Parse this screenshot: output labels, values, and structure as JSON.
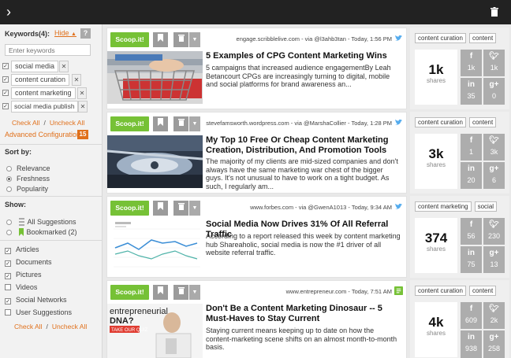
{
  "topbar": {
    "chevron_icon": "chevron-right-icon",
    "trash_icon": "trash-icon"
  },
  "sidebar": {
    "keywords_heading": "Keywords(4):",
    "hide_label": "Hide",
    "help_label": "?",
    "keyword_input_placeholder": "Enter keywords",
    "keywords": [
      {
        "label": "social media",
        "checked": true
      },
      {
        "label": "content curation",
        "checked": true
      },
      {
        "label": "content marketing",
        "checked": true
      },
      {
        "label": "social media publish",
        "checked": true
      }
    ],
    "check_all": "Check All",
    "uncheck_all": "Uncheck All",
    "advanced_configuration": "Advanced Configuration",
    "advanced_count": "15",
    "sort_heading": "Sort by:",
    "sort_options": [
      {
        "label": "Relevance",
        "selected": false
      },
      {
        "label": "Freshness",
        "selected": true
      },
      {
        "label": "Popularity",
        "selected": false
      }
    ],
    "show_heading": "Show:",
    "show_options": [
      {
        "label": "All Suggestions",
        "selected": false
      },
      {
        "label": "Bookmarked (2)",
        "selected": false
      }
    ],
    "types": [
      {
        "label": "Articles",
        "checked": true
      },
      {
        "label": "Documents",
        "checked": true
      },
      {
        "label": "Pictures",
        "checked": true
      },
      {
        "label": "Videos",
        "checked": false
      },
      {
        "label": "Social Networks",
        "checked": true
      },
      {
        "label": "User Suggestions",
        "checked": false
      }
    ],
    "check_all_2": "Check All",
    "uncheck_all_2": "Uncheck All"
  },
  "card_buttons": {
    "scoop": "Scoop.it!",
    "bookmark_icon": "bookmark-icon",
    "delete_icon": "trash-icon",
    "dropdown_icon": "caret-down-icon"
  },
  "cards": [
    {
      "meta": "engage.scribblelive.com - via @l3ahb3tan - Today, 1:56 PM",
      "source_icon": "twitter-icon",
      "title": "5 Examples of CPG Content Marketing Wins",
      "description": "5 campaigns that increased audience engagementBy Leah Betancourt CPGs are increasingly turning to digital, mobile and social platforms for brand awareness an...",
      "tags": [
        "content curation",
        "content"
      ],
      "shares": "1k",
      "shares_label": "shares",
      "facebook": "1k",
      "twitter": "1k",
      "linkedin": "35",
      "googleplus": "0"
    },
    {
      "meta": "stevefamsworth.wordpress.com - via @MarshaCollier - Today, 1:28 PM",
      "source_icon": "twitter-icon",
      "title": "My Top 10 Free Or Cheap Content Marketing Creation, Distribution, And Promotion Tools",
      "description": "The majority of my clients are mid-sized companies and don't always have the same marketing war chest of the bigger guys. It's not unusual to have to work on a tight budget. As such, I regularly am...",
      "tags": [
        "content curation",
        "content"
      ],
      "shares": "3k",
      "shares_label": "shares",
      "facebook": "1",
      "twitter": "3k",
      "linkedin": "20",
      "googleplus": "6"
    },
    {
      "meta": "www.forbes.com - via @GwenA1013 - Today, 9:34 AM",
      "source_icon": "twitter-icon",
      "title": "Social Media Now Drives 31% Of All Referral Traffic",
      "description": "According to a report released this week by content marketing hub Shareaholic, social media is now the #1 driver of all website referral traffic.",
      "tags": [
        "content marketing",
        "social"
      ],
      "shares": "374",
      "shares_label": "shares",
      "facebook": "56",
      "twitter": "230",
      "linkedin": "75",
      "googleplus": "13"
    },
    {
      "meta": "www.entrepreneur.com - Today, 7:51 AM",
      "source_icon": "feed-icon",
      "title": "Don't Be a Content Marketing Dinosaur -- 5 Must-Haves to Stay Current",
      "description": "Staying current means keeping up to date on how the content-marketing scene shifts on an almost month-to-month basis.",
      "thumb_text_1": "entrepreneurial",
      "thumb_text_2": "DNA?",
      "thumb_text_3": "TAKE OUR QUIZ",
      "tags": [
        "content curation",
        "content"
      ],
      "shares": "4k",
      "shares_label": "shares",
      "facebook": "609",
      "twitter": "2k",
      "linkedin": "938",
      "googleplus": "258"
    }
  ],
  "colors": {
    "accent": "#e0701b",
    "scoop_green": "#76c136",
    "topbar": "#222222",
    "twitter_blue": "#55acee"
  }
}
